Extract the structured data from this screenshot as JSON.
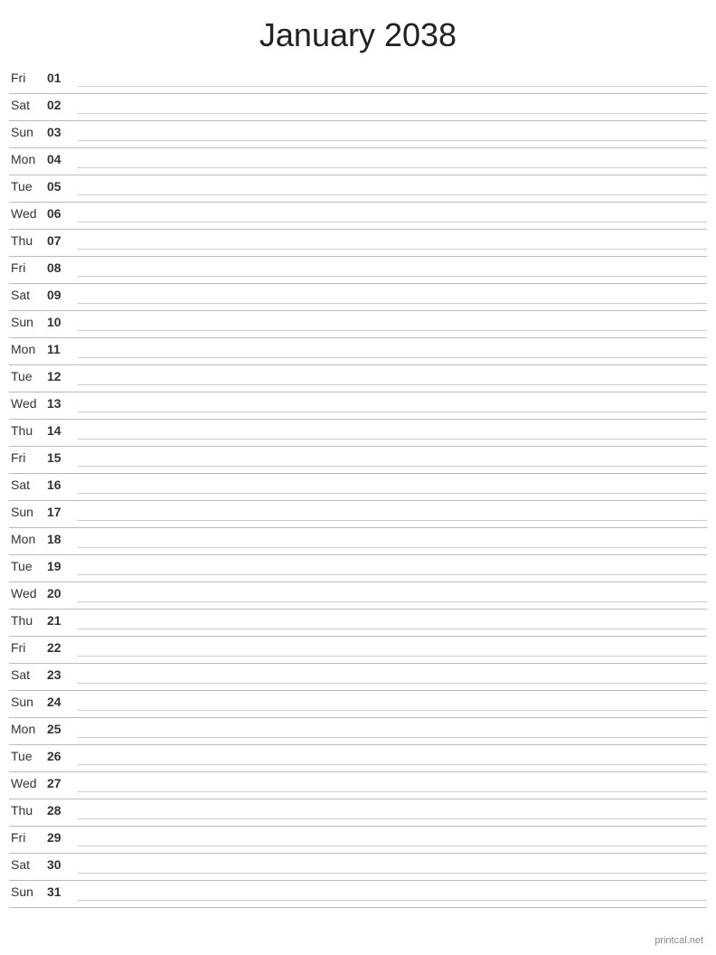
{
  "header": {
    "title": "January 2038"
  },
  "days": [
    {
      "name": "Fri",
      "number": "01"
    },
    {
      "name": "Sat",
      "number": "02"
    },
    {
      "name": "Sun",
      "number": "03"
    },
    {
      "name": "Mon",
      "number": "04"
    },
    {
      "name": "Tue",
      "number": "05"
    },
    {
      "name": "Wed",
      "number": "06"
    },
    {
      "name": "Thu",
      "number": "07"
    },
    {
      "name": "Fri",
      "number": "08"
    },
    {
      "name": "Sat",
      "number": "09"
    },
    {
      "name": "Sun",
      "number": "10"
    },
    {
      "name": "Mon",
      "number": "11"
    },
    {
      "name": "Tue",
      "number": "12"
    },
    {
      "name": "Wed",
      "number": "13"
    },
    {
      "name": "Thu",
      "number": "14"
    },
    {
      "name": "Fri",
      "number": "15"
    },
    {
      "name": "Sat",
      "number": "16"
    },
    {
      "name": "Sun",
      "number": "17"
    },
    {
      "name": "Mon",
      "number": "18"
    },
    {
      "name": "Tue",
      "number": "19"
    },
    {
      "name": "Wed",
      "number": "20"
    },
    {
      "name": "Thu",
      "number": "21"
    },
    {
      "name": "Fri",
      "number": "22"
    },
    {
      "name": "Sat",
      "number": "23"
    },
    {
      "name": "Sun",
      "number": "24"
    },
    {
      "name": "Mon",
      "number": "25"
    },
    {
      "name": "Tue",
      "number": "26"
    },
    {
      "name": "Wed",
      "number": "27"
    },
    {
      "name": "Thu",
      "number": "28"
    },
    {
      "name": "Fri",
      "number": "29"
    },
    {
      "name": "Sat",
      "number": "30"
    },
    {
      "name": "Sun",
      "number": "31"
    }
  ],
  "footer": {
    "text": "printcal.net"
  }
}
